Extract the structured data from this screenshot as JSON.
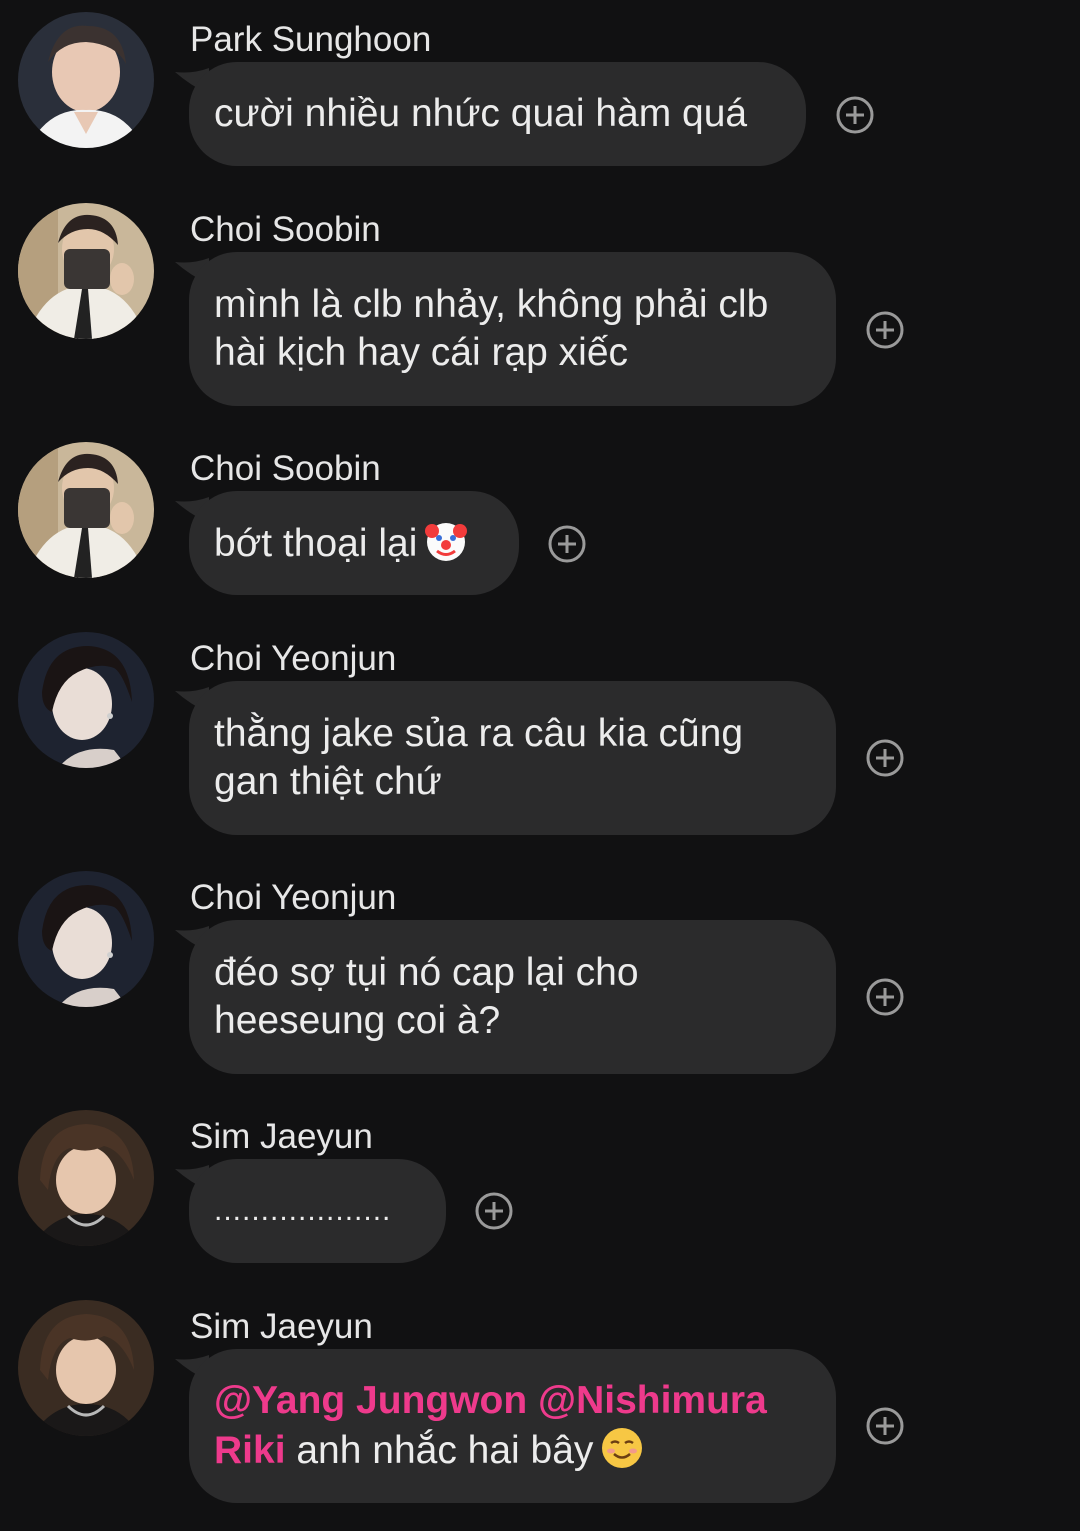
{
  "colors": {
    "background": "#111112",
    "bubble": "#2b2b2c",
    "text": "#ececec",
    "mention": "#ee3a8c"
  },
  "messages": [
    {
      "sender": "Park Sunghoon",
      "avatar_icon": "profile-photo-icon",
      "lines": [
        "cười nhiều nhức quai hàm quá"
      ]
    },
    {
      "sender": "Choi Soobin",
      "avatar_icon": "profile-photo-icon",
      "lines": [
        "mình là clb nhảy, không phải clb",
        "hài kịch hay cái rạp xiếc"
      ]
    },
    {
      "sender": "Choi Soobin",
      "avatar_icon": "profile-photo-icon",
      "lines": [
        "bớt thoại lại"
      ],
      "emoji": "clown-face-icon"
    },
    {
      "sender": "Choi Yeonjun",
      "avatar_icon": "profile-photo-icon",
      "lines": [
        "thằng jake sủa ra câu kia cũng",
        "gan thiệt chứ"
      ]
    },
    {
      "sender": "Choi Yeonjun",
      "avatar_icon": "profile-photo-icon",
      "lines": [
        "đéo sợ tụi nó cap lại cho",
        "heeseung coi à?"
      ]
    },
    {
      "sender": "Sim Jaeyun",
      "avatar_icon": "profile-photo-icon",
      "lines": [
        "..................."
      ]
    },
    {
      "sender": "Sim Jaeyun",
      "avatar_icon": "profile-photo-icon",
      "mention1": "@Yang Jungwon",
      "mention2": "@Nishimura",
      "mention3": "Riki",
      "rest": " anh nhắc hai bây",
      "emoji": "smiling-face-icon"
    }
  ],
  "reaction_icon": "add-reaction-icon"
}
